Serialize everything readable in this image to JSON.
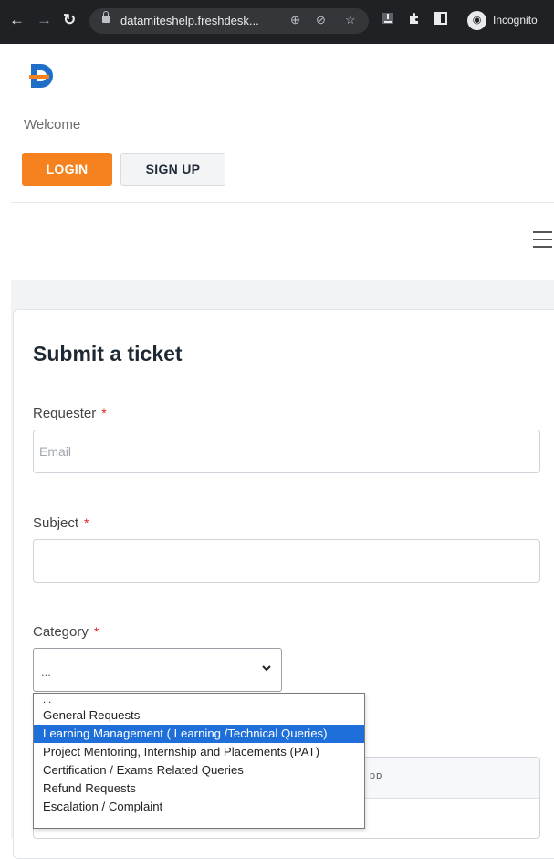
{
  "browser": {
    "url": "datamiteshelp.freshdesk...",
    "profile_label": "Incognito"
  },
  "header": {
    "welcome": "Welcome",
    "login_label": "LOGIN",
    "signup_label": "SIGN UP",
    "logo_letter": "D"
  },
  "form": {
    "title": "Submit a ticket",
    "requester": {
      "label": "Requester",
      "required": "*",
      "placeholder": "Email"
    },
    "subject": {
      "label": "Subject",
      "required": "*",
      "value": ""
    },
    "category": {
      "label": "Category",
      "required": "*",
      "selected_value": "...",
      "options": [
        "...",
        "General Requests",
        "Learning Management ( Learning /Technical Queries)",
        "Project Mentoring, Internship and Placements (PAT)",
        "Certification / Exams Related Queries",
        "Refund Requests",
        "Escalation / Complaint"
      ],
      "highlighted_index": 2
    }
  },
  "background_fragment": "ᴅᴅ",
  "colors": {
    "login_bg": "#f5821f",
    "logo_blue": "#1f6fc9",
    "logo_orange": "#f5821f",
    "highlight": "#1e6fd9",
    "required_star": "#e02424",
    "browser_bar": "#202124"
  }
}
